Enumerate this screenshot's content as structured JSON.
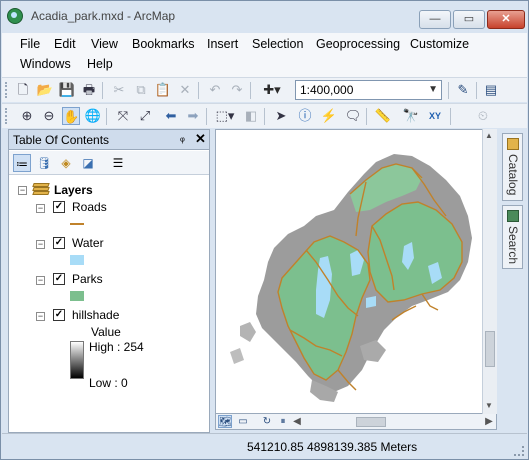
{
  "window": {
    "title": "Acadia_park.mxd - ArcMap",
    "minimize": "—",
    "maximize": "▭",
    "close": "✕"
  },
  "menu": [
    "File",
    "Edit",
    "View",
    "Bookmarks",
    "Insert",
    "Selection",
    "Geoprocessing",
    "Customize",
    "Windows",
    "Help"
  ],
  "standard_toolbar": {
    "scale": "1:400,000",
    "icons": [
      "new-document-icon",
      "open-folder-icon",
      "save-icon",
      "print-icon",
      "cut-icon",
      "copy-icon",
      "paste-icon",
      "delete-icon",
      "undo-icon",
      "redo-icon",
      "add-data-icon",
      "editor-toolbar-icon",
      "layout-toolbar-icon"
    ]
  },
  "tools_toolbar": {
    "icons": [
      "zoom-in-icon",
      "zoom-out-icon",
      "pan-icon",
      "full-extent-icon",
      "fixed-zoom-in-icon",
      "fixed-zoom-out-icon",
      "back-icon",
      "forward-icon",
      "select-features-icon",
      "clear-selection-icon",
      "select-elements-icon",
      "identify-icon",
      "hyperlink-icon",
      "html-popup-icon",
      "measure-icon",
      "find-icon",
      "go-to-xy-icon",
      "time-slider-icon"
    ]
  },
  "toc": {
    "title": "Table Of Contents",
    "pin": "ᵩ",
    "close": "✕",
    "data_frame": "Layers",
    "layers": [
      {
        "name": "Roads",
        "checked": true,
        "symbol": "line",
        "color": "#c0822b"
      },
      {
        "name": "Water",
        "checked": true,
        "symbol": "fill",
        "color": "#a8dcf7"
      },
      {
        "name": "Parks",
        "checked": true,
        "symbol": "fill",
        "color": "#7cbf8e"
      },
      {
        "name": "hillshade",
        "checked": true,
        "symbol": "raster"
      }
    ],
    "raster_legend": {
      "label": "Value",
      "high": "High : 254",
      "low": "Low : 0"
    }
  },
  "side_tabs": {
    "catalog": "Catalog",
    "search": "Search"
  },
  "status": {
    "coordinates": "541210.85  4898139.385 Meters"
  },
  "colors": {
    "roads": "#c0822b",
    "water": "#a8dcf7",
    "parks": "#7cbf8e"
  }
}
